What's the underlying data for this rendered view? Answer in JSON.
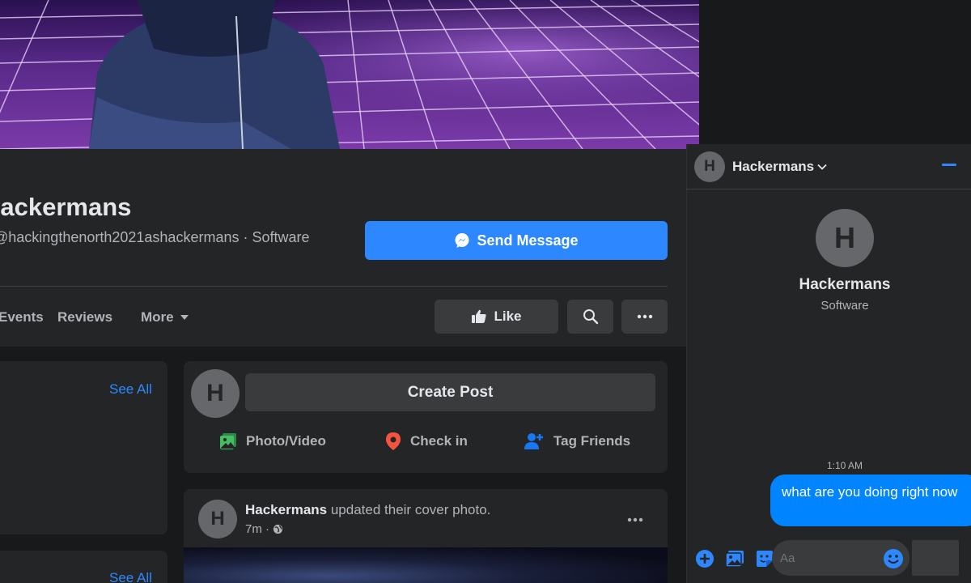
{
  "page": {
    "name": "Hackermans",
    "subtitle": "@hackingthenorth2021ashackermans · Software",
    "send_message_label": "Send Message",
    "tabs": [
      "Events",
      "Reviews",
      "More"
    ],
    "like_label": "Like",
    "avatar_letter": "H"
  },
  "sidebar": {
    "see_all_1": "See All",
    "see_all_2": "See All"
  },
  "create_post": {
    "button_label": "Create Post",
    "photo_video": "Photo/Video",
    "check_in": "Check in",
    "tag_friends": "Tag Friends"
  },
  "post": {
    "author": "Hackermans",
    "action": " updated their cover photo.",
    "time": "7m ·"
  },
  "chat": {
    "header_name": "Hackermans",
    "profile_name": "Hackermans",
    "profile_category": "Software",
    "timestamp": "1:10 AM",
    "message": "what are you doing right now",
    "input_placeholder": "Aa"
  },
  "colors": {
    "accent": "#2d88ff",
    "bubble": "#0084ff",
    "surface": "#242526",
    "background": "#18191a"
  }
}
